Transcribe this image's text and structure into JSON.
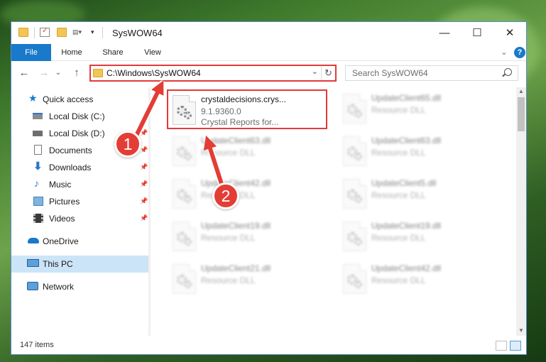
{
  "window": {
    "title": "SysWOW64",
    "minimize_label": "—",
    "maximize_label": "☐",
    "close_label": "✕"
  },
  "ribbon": {
    "tabs": [
      {
        "label": "File"
      },
      {
        "label": "Home"
      },
      {
        "label": "Share"
      },
      {
        "label": "View"
      }
    ],
    "expand_label": "⌄",
    "help_label": "?"
  },
  "address_bar": {
    "path": "C:\\Windows\\SysWOW64",
    "dropdown_label": "⌄",
    "refresh_label": "↻"
  },
  "search": {
    "placeholder": "Search SysWOW64"
  },
  "navigation": {
    "back_label": "←",
    "forward_label": "→",
    "recent_label": "⌄",
    "up_label": "↑"
  },
  "sidebar": {
    "items": [
      {
        "label": "Quick access",
        "icon": "star-icon"
      },
      {
        "label": "Local Disk (C:)",
        "icon": "drive-icon"
      },
      {
        "label": "Local Disk (D:)",
        "icon": "drive-icon"
      },
      {
        "label": "Documents",
        "icon": "documents-icon"
      },
      {
        "label": "Downloads",
        "icon": "download-icon"
      },
      {
        "label": "Music",
        "icon": "music-icon"
      },
      {
        "label": "Pictures",
        "icon": "pictures-icon"
      },
      {
        "label": "Videos",
        "icon": "videos-icon"
      },
      {
        "label": "OneDrive",
        "icon": "cloud-icon"
      },
      {
        "label": "This PC",
        "icon": "computer-icon"
      },
      {
        "label": "Network",
        "icon": "network-icon"
      }
    ],
    "pin_label": "📌"
  },
  "files": [
    {
      "name": "crystaldecisions.crys...",
      "line2": "9.1.9360.0",
      "line3": "Crystal Reports for..."
    },
    {
      "name": "UpdateClient65.dll",
      "line2": "Resource DLL",
      "line3": ""
    },
    {
      "name": "UpdateClient63.dll",
      "line2": "Resource DLL",
      "line3": ""
    },
    {
      "name": "UpdateClient63.dll",
      "line2": "Resource DLL",
      "line3": ""
    },
    {
      "name": "UpdateClient42.dll",
      "line2": "Resource DLL",
      "line3": ""
    },
    {
      "name": "UpdateClient5.dll",
      "line2": "Resource DLL",
      "line3": ""
    },
    {
      "name": "UpdateClient19.dll",
      "line2": "Resource DLL",
      "line3": ""
    },
    {
      "name": "UpdateClient19.dll",
      "line2": "Resource DLL",
      "line3": ""
    },
    {
      "name": "UpdateClient21.dll",
      "line2": "Resource DLL",
      "line3": ""
    },
    {
      "name": "UpdateClient42.dll",
      "line2": "Resource DLL",
      "line3": ""
    }
  ],
  "status": {
    "item_count": "147 items"
  },
  "annotations": {
    "badge_1": "1",
    "badge_2": "2",
    "accent_color": "#e33d36"
  },
  "colors": {
    "accent_blue": "#1979ca",
    "selection": "#cce4f7",
    "highlight_red": "#e23a3a"
  }
}
